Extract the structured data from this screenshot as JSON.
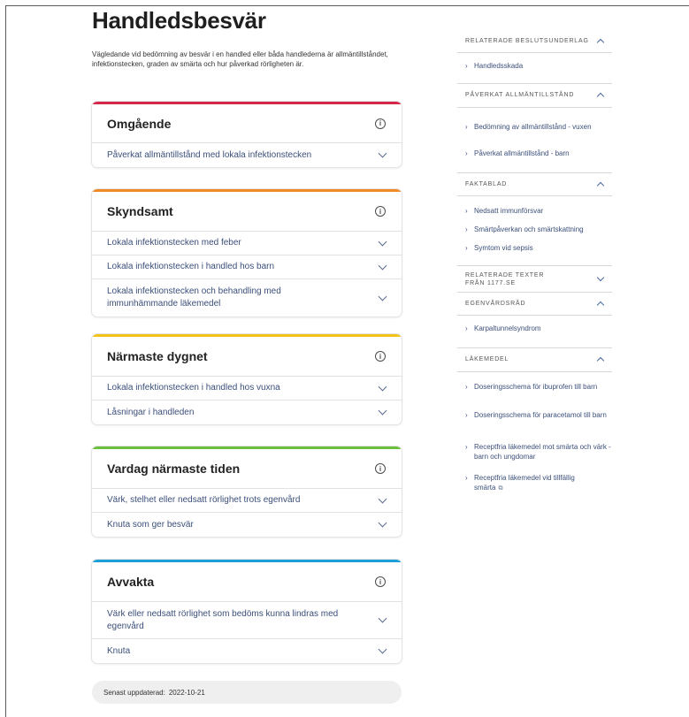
{
  "page": {
    "title": "Handledsbesvär",
    "lead": "Vägledande vid bedömning av besvär i en handled eller båda handlederna är allmäntillståndet, infektionstecken, graden av smärta och hur påverkad rörligheten är."
  },
  "colors": {
    "omgaende": "#d6264a",
    "skyndsamt": "#f08a24",
    "narmaste_dygnet": "#f2c318",
    "vardag": "#6cbf3c",
    "avvakta": "#1e9fd8",
    "link": "#3b4f7a"
  },
  "cards": [
    {
      "title": "Omgående",
      "items": [
        "Påverkat allmäntillstånd med lokala infektionstecken"
      ]
    },
    {
      "title": "Skyndsamt",
      "items": [
        "Lokala infektionstecken med feber",
        "Lokala infektionstecken i handled hos barn",
        "Lokala infektionstecken och behandling med immunhämmande läkemedel"
      ]
    },
    {
      "title": "Närmaste dygnet",
      "items": [
        "Lokala infektionstecken i handled hos vuxna",
        "Låsningar i handleden"
      ]
    },
    {
      "title": "Vardag närmaste tiden",
      "items": [
        "Värk, stelhet eller nedsatt rörlighet trots egenvård",
        "Knuta som ger besvär"
      ]
    },
    {
      "title": "Avvakta",
      "items": [
        "Värk eller nedsatt rörlighet som bedöms kunna lindras med egenvård",
        "Knuta"
      ]
    }
  ],
  "updated": {
    "label": "Senast uppdaterad:",
    "date": "2022-10-21"
  },
  "sidebar": {
    "sections": [
      {
        "title": "RELATERADE BESLUTSUNDERLAG",
        "expanded": true,
        "links": [
          "Handledsskada"
        ]
      },
      {
        "title": "PÅVERKAT ALLMÄNTILLSTÅND",
        "expanded": true,
        "links": [
          "Bedömning av allmäntillstånd - vuxen",
          "Påverkat allmäntillstånd - barn"
        ]
      },
      {
        "title": "FAKTABLAD",
        "expanded": true,
        "links": [
          "Nedsatt immunförsvar",
          "Smärtpåverkan och smärtskattning",
          "Symtom vid sepsis"
        ]
      },
      {
        "title": "RELATERADE TEXTER FRÅN 1177.SE",
        "expanded": false,
        "links": []
      },
      {
        "title": "EGENVÅRDSRÅD",
        "expanded": true,
        "links": [
          "Karpaltunnelsyndrom"
        ]
      },
      {
        "title": "LÄKEMEDEL",
        "expanded": true,
        "links": [
          "Doseringsschema för ibuprofen till barn",
          "Doseringsschema för paracetamol till barn",
          "Receptfria läkemedel mot smärta och värk - barn och ungdomar",
          "Receptfria läkemedel vid tillfällig smärta"
        ]
      }
    ]
  },
  "icons": {
    "info": "i",
    "external": "⧉"
  }
}
